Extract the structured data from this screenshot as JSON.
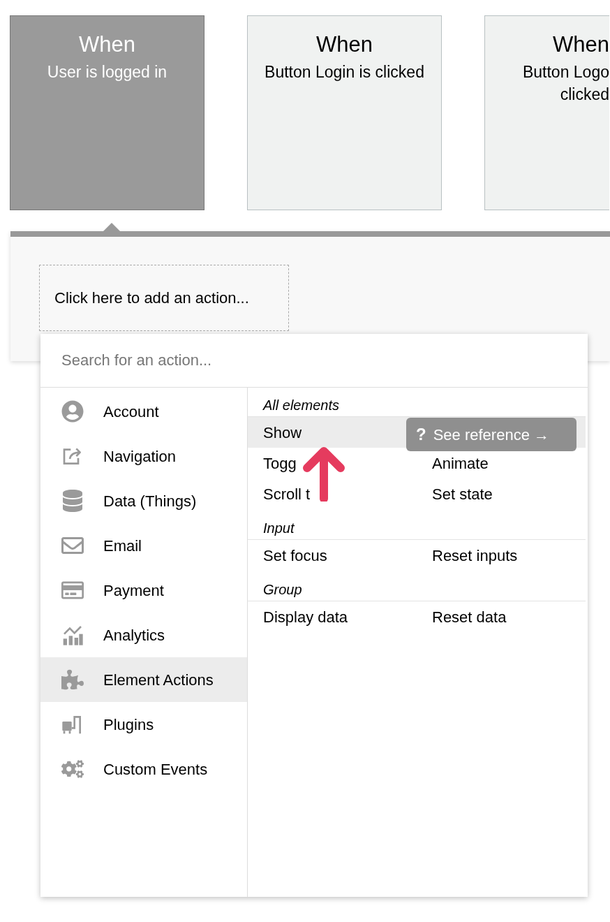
{
  "events": [
    {
      "title": "When",
      "lines": [
        "User is logged in"
      ],
      "selected": true
    },
    {
      "title": "When",
      "lines": [
        "Button Login is clicked"
      ],
      "selected": false
    },
    {
      "title": "When",
      "lines": [
        "Button Logo",
        "clicked"
      ],
      "selected": false
    }
  ],
  "workflow": {
    "add_action": "Click here to add an action..."
  },
  "picker": {
    "search": {
      "placeholder": "Search for an action..."
    },
    "categories": [
      {
        "label": "Account",
        "selected": false
      },
      {
        "label": "Navigation",
        "selected": false
      },
      {
        "label": "Data (Things)",
        "selected": false
      },
      {
        "label": "Email",
        "selected": false
      },
      {
        "label": "Payment",
        "selected": false
      },
      {
        "label": "Analytics",
        "selected": false
      },
      {
        "label": "Element Actions",
        "selected": true
      },
      {
        "label": "Plugins",
        "selected": false
      },
      {
        "label": "Custom Events",
        "selected": false
      }
    ],
    "sections": [
      {
        "title": "All elements",
        "rows": [
          {
            "items": [
              "Show"
            ],
            "highlighted": true
          },
          {
            "items": [
              "Togg",
              "Animate"
            ],
            "highlighted": false
          },
          {
            "items": [
              "Scroll t",
              "Set state"
            ],
            "highlighted": false
          }
        ]
      },
      {
        "title": "Input",
        "rows": [
          {
            "items": [
              "Set focus",
              "Reset inputs"
            ],
            "highlighted": false
          }
        ]
      },
      {
        "title": "Group",
        "rows": [
          {
            "items": [
              "Display data",
              "Reset data"
            ],
            "highlighted": false
          }
        ]
      }
    ],
    "tooltip": {
      "icon": "?",
      "label": "See reference →"
    }
  }
}
